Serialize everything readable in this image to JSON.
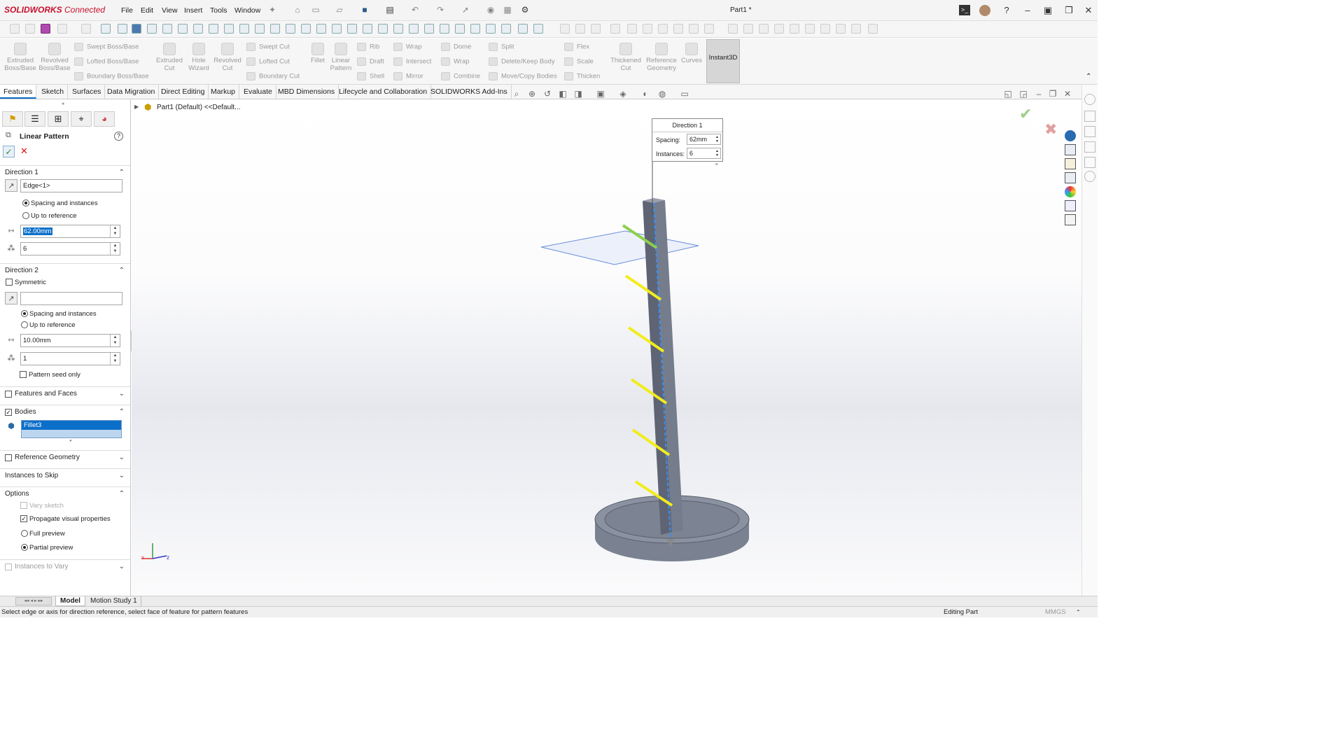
{
  "app": {
    "brand": "SOLIDWORKS",
    "brand_suffix": "Connected",
    "document_title": "Part1 *"
  },
  "menus": [
    "File",
    "Edit",
    "View",
    "Insert",
    "Tools",
    "Window"
  ],
  "ribbon": {
    "large": [
      {
        "l1": "Extruded",
        "l2": "Boss/Base"
      },
      {
        "l1": "Revolved",
        "l2": "Boss/Base"
      },
      {
        "l1": "Extruded",
        "l2": "Cut"
      },
      {
        "l1": "Hole",
        "l2": "Wizard"
      },
      {
        "l1": "Revolved",
        "l2": "Cut"
      },
      {
        "l1": "Fillet",
        "l2": ""
      },
      {
        "l1": "Linear",
        "l2": "Pattern"
      },
      {
        "l1": "Thickened",
        "l2": "Cut"
      },
      {
        "l1": "Reference",
        "l2": "Geometry"
      },
      {
        "l1": "Curves",
        "l2": ""
      }
    ],
    "small": [
      "Swept Boss/Base",
      "Lofted Boss/Base",
      "Boundary Boss/Base",
      "Swept Cut",
      "Lofted Cut",
      "Boundary Cut",
      "Rib",
      "Draft",
      "Shell",
      "Wrap",
      "Intersect",
      "Mirror",
      "Dome",
      "Wrap",
      "Combine",
      "Split",
      "Delete/Keep Body",
      "Move/Copy Bodies",
      "Flex",
      "Scale",
      "Thicken"
    ],
    "instant3d": "Instant3D"
  },
  "tabs": [
    "Features",
    "Sketch",
    "Surfaces",
    "Data Migration",
    "Direct Editing",
    "Markup",
    "Evaluate",
    "MBD Dimensions",
    "Lifecycle and Collaboration",
    "SOLIDWORKS Add-Ins"
  ],
  "panel": {
    "title": "Linear Pattern",
    "dir1": {
      "header": "Direction 1",
      "edge": "Edge<1>",
      "opt_spacing": "Spacing and instances",
      "opt_ref": "Up to reference",
      "spacing": "62.00mm",
      "instances": "6"
    },
    "dir2": {
      "header": "Direction 2",
      "symmetric": "Symmetric",
      "edge": "",
      "opt_spacing": "Spacing and instances",
      "opt_ref": "Up to reference",
      "spacing": "10.00mm",
      "instances": "1",
      "seed_only": "Pattern seed only"
    },
    "features_faces": "Features and Faces",
    "bodies": {
      "header": "Bodies",
      "item": "Fillet3"
    },
    "reference_geometry": "Reference Geometry",
    "instances_to_skip": "Instances to Skip",
    "options": {
      "header": "Options",
      "vary_sketch": "Vary sketch",
      "propagate": "Propagate visual properties",
      "full_preview": "Full preview",
      "partial_preview": "Partial preview"
    },
    "instances_to_vary": "Instances to Vary"
  },
  "tree": {
    "root": "Part1 (Default) <<Default..."
  },
  "callout": {
    "title": "Direction 1",
    "spacing_label": "Spacing:",
    "spacing_value": "62mm",
    "instances_label": "Instances:",
    "instances_value": "6"
  },
  "bottom_tabs": [
    "Model",
    "Motion Study 1"
  ],
  "status": {
    "message": "Select edge or axis for direction reference, select face of feature for pattern features",
    "mode": "Editing Part",
    "units": "MMGS"
  },
  "colors": {
    "accent": "#0b6fc9",
    "brand": "#c8102e",
    "preview": "#f2ec1c",
    "body": "#6e7585"
  }
}
